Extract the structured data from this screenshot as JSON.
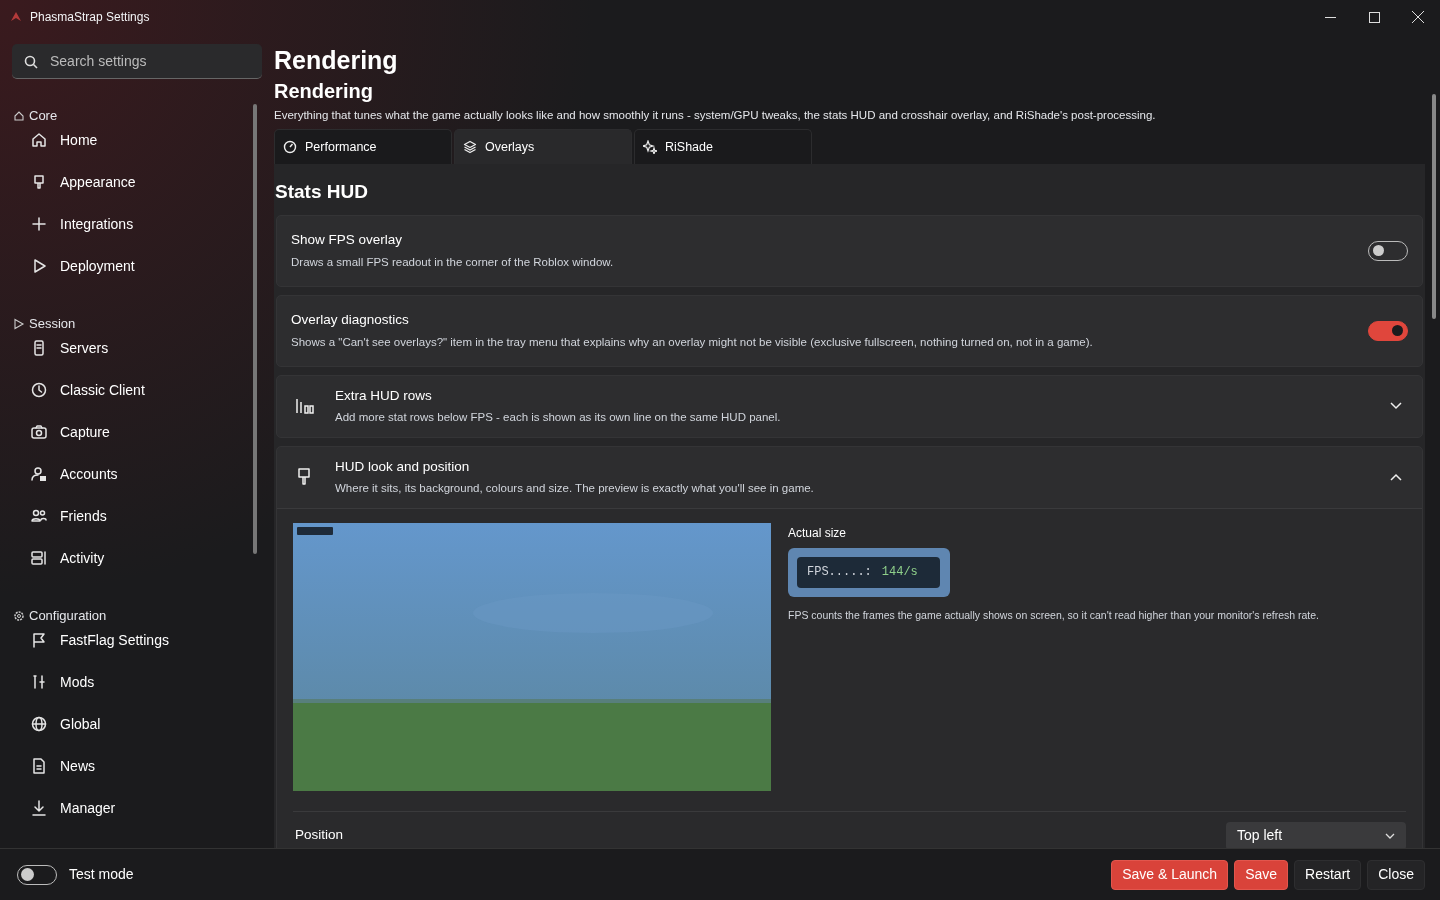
{
  "window": {
    "title": "PhasmaStrap Settings"
  },
  "search": {
    "placeholder": "Search settings"
  },
  "sidebar": {
    "groups": [
      {
        "label": "Core",
        "items": [
          {
            "label": "Home",
            "selected": false
          },
          {
            "label": "Appearance",
            "selected": false
          },
          {
            "label": "Integrations",
            "selected": false
          },
          {
            "label": "Deployment",
            "selected": false
          }
        ]
      },
      {
        "label": "Session",
        "items": [
          {
            "label": "Servers",
            "selected": false
          },
          {
            "label": "Classic Client",
            "selected": false
          },
          {
            "label": "Capture",
            "selected": false
          },
          {
            "label": "Accounts",
            "selected": false
          },
          {
            "label": "Friends",
            "selected": false
          },
          {
            "label": "Activity",
            "selected": false
          }
        ]
      },
      {
        "label": "Configuration",
        "items": [
          {
            "label": "FastFlag Settings",
            "selected": false
          },
          {
            "label": "Mods",
            "selected": false
          },
          {
            "label": "Global",
            "selected": false
          },
          {
            "label": "News",
            "selected": false
          },
          {
            "label": "Manager",
            "selected": false
          }
        ]
      }
    ]
  },
  "page": {
    "title": "Rendering",
    "subtitle": "Rendering",
    "description": "Everything that tunes what the game actually looks like and how smoothly it runs - system/GPU tweaks, the stats HUD and crosshair overlay, and RiShade's post-processing."
  },
  "tabs": [
    {
      "label": "Performance",
      "selected": false
    },
    {
      "label": "Overlays",
      "selected": true
    },
    {
      "label": "RiShade",
      "selected": false
    }
  ],
  "section": {
    "title": "Stats HUD"
  },
  "settings": [
    {
      "kind": "toggle",
      "title": "Show FPS overlay",
      "description": "Draws a small FPS readout in the corner of the Roblox window.",
      "on": false
    },
    {
      "kind": "toggle",
      "title": "Overlay diagnostics",
      "description": "Shows a \"Can't see overlays?\" item in the tray menu that explains why an overlay might not be visible (exclusive fullscreen, nothing turned on, not in a game).",
      "on": true
    },
    {
      "kind": "expander",
      "title": "Extra HUD rows",
      "description": "Add more stat rows below FPS - each is shown as its own line on the same HUD panel.",
      "expanded": false
    },
    {
      "kind": "expander",
      "title": "HUD look and position",
      "description": "Where it sits, its background, colours and size. The preview is exactly what you'll see in game.",
      "expanded": true
    }
  ],
  "hud_preview": {
    "actual_size_label": "Actual size",
    "sample_label": "FPS.....:",
    "sample_value": "144/s",
    "note": "FPS counts the frames the game actually shows on screen, so it can't read higher than your monitor's refresh rate.",
    "position": {
      "label": "Position",
      "value": "Top left"
    }
  },
  "footer": {
    "test_mode": {
      "label": "Test mode",
      "on": false
    },
    "buttons": [
      {
        "label": "Save & Launch",
        "kind": "primary"
      },
      {
        "label": "Save",
        "kind": "primary"
      },
      {
        "label": "Restart",
        "kind": "secondary"
      },
      {
        "label": "Close",
        "kind": "secondary"
      }
    ]
  }
}
